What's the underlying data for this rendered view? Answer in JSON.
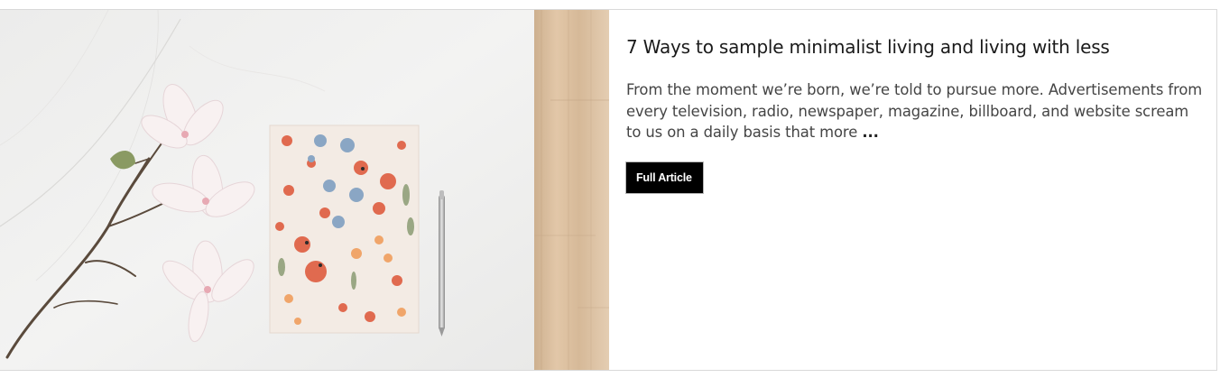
{
  "article": {
    "title": "7 Ways to sample minimalist living and living with less",
    "excerpt": "From the moment we’re born, we’re told to pursue more. Advertisements from every television, radio, newspaper, magazine, billboard, and website scream to us on a daily basis that more",
    "ellipsis": "...",
    "button_label": "Full Article"
  },
  "image": {
    "subject": "floral notebook with pen and magnolia branch on marble",
    "icon": "article-thumbnail-image"
  },
  "colors": {
    "button_bg": "#000000",
    "button_text": "#ffffff",
    "title": "#1a1a1a",
    "body": "#454545",
    "wood": "#d7b999"
  }
}
